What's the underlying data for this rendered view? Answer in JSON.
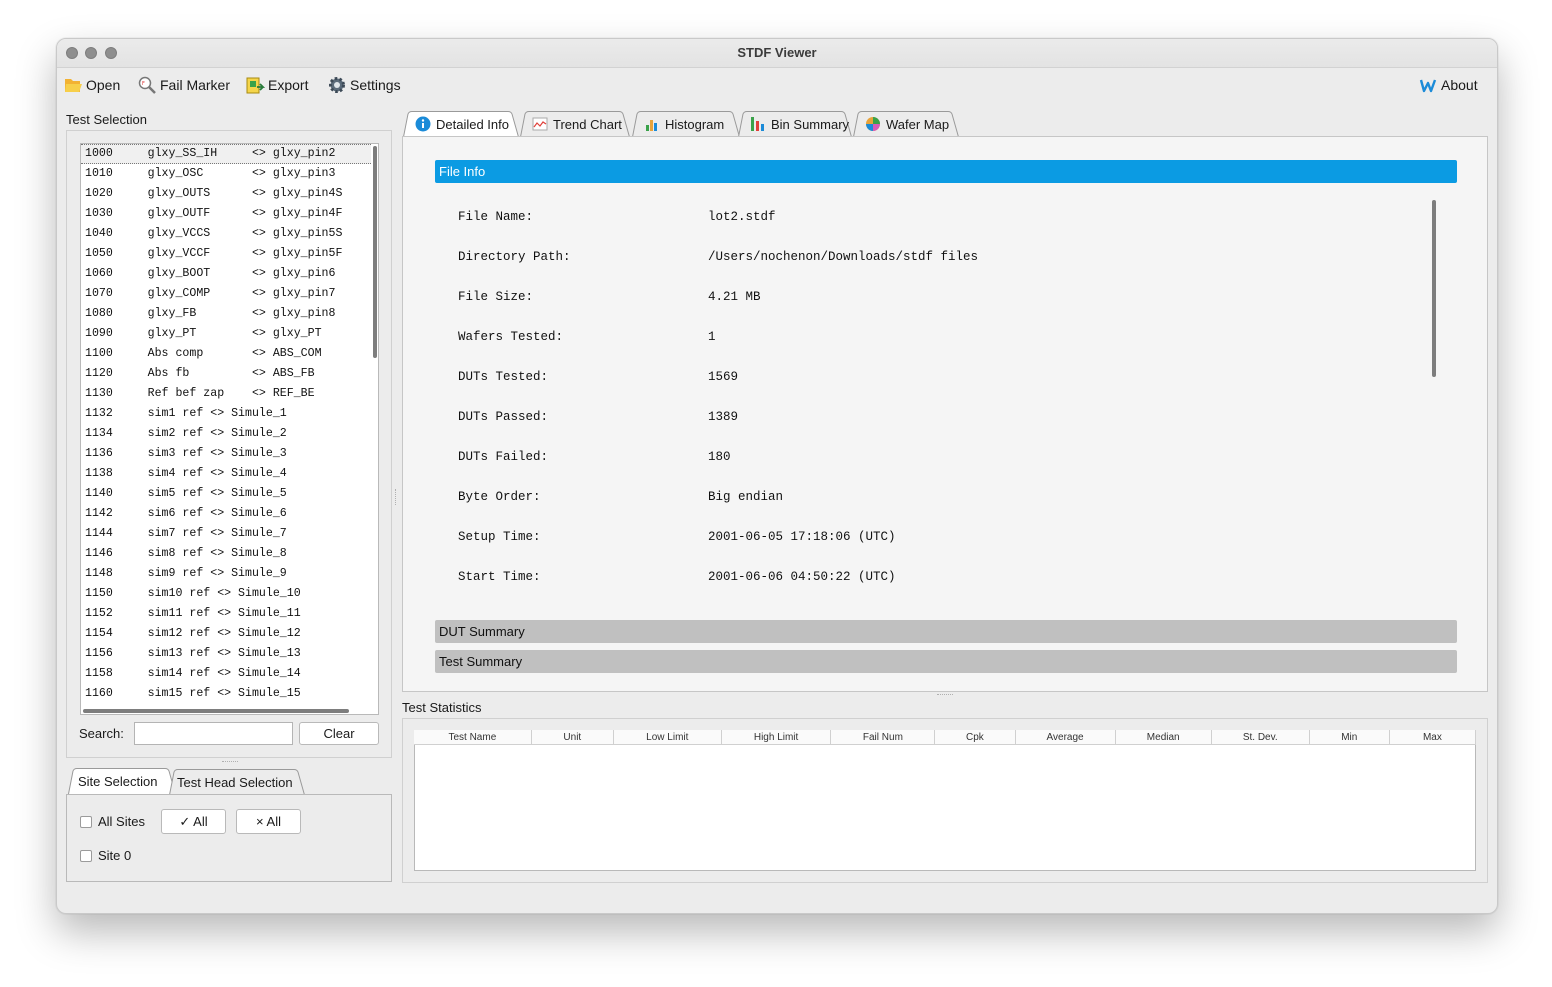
{
  "window": {
    "title": "STDF Viewer"
  },
  "toolbar": {
    "open": "Open",
    "fail_marker": "Fail Marker",
    "export": "Export",
    "settings": "Settings",
    "about": "About"
  },
  "test_selection": {
    "label": "Test Selection",
    "rows": [
      "1000     glxy_SS_IH     <> glxy_pin2",
      "1010     glxy_OSC       <> glxy_pin3",
      "1020     glxy_OUTS      <> glxy_pin4S",
      "1030     glxy_OUTF      <> glxy_pin4F",
      "1040     glxy_VCCS      <> glxy_pin5S",
      "1050     glxy_VCCF      <> glxy_pin5F",
      "1060     glxy_BOOT      <> glxy_pin6",
      "1070     glxy_COMP      <> glxy_pin7",
      "1080     glxy_FB        <> glxy_pin8",
      "1090     glxy_PT        <> glxy_PT",
      "1100     Abs comp       <> ABS_COM",
      "1120     Abs fb         <> ABS_FB",
      "1130     Ref bef zap    <> REF_BE",
      "1132     sim1 ref <> Simule_1",
      "1134     sim2 ref <> Simule_2",
      "1136     sim3 ref <> Simule_3",
      "1138     sim4 ref <> Simule_4",
      "1140     sim5 ref <> Simule_5",
      "1142     sim6 ref <> Simule_6",
      "1144     sim7 ref <> Simule_7",
      "1146     sim8 ref <> Simule_8",
      "1148     sim9 ref <> Simule_9",
      "1150     sim10 ref <> Simule_10",
      "1152     sim11 ref <> Simule_11",
      "1154     sim12 ref <> Simule_12",
      "1156     sim13 ref <> Simule_13",
      "1158     sim14 ref <> Simule_14",
      "1160     sim15 ref <> Simule_15"
    ],
    "search_label": "Search:",
    "search_value": "",
    "clear_button": "Clear"
  },
  "site_panel": {
    "tabs": [
      "Site Selection",
      "Test Head Selection"
    ],
    "all_sites": "All Sites",
    "check_all": "✓ All",
    "uncheck_all": "× All",
    "site0": "Site 0"
  },
  "main_tabs": [
    "Detailed Info",
    "Trend Chart",
    "Histogram",
    "Bin Summary",
    "Wafer Map"
  ],
  "file_info": {
    "header": "File Info",
    "rows": [
      {
        "label": "File Name:",
        "value": "lot2.stdf"
      },
      {
        "label": "Directory Path:",
        "value": "/Users/nochenon/Downloads/stdf files"
      },
      {
        "label": "File Size:",
        "value": "4.21 MB"
      },
      {
        "label": "Wafers Tested:",
        "value": "1"
      },
      {
        "label": "DUTs Tested:",
        "value": "1569"
      },
      {
        "label": "DUTs Passed:",
        "value": "1389"
      },
      {
        "label": "DUTs Failed:",
        "value": "180"
      },
      {
        "label": "Byte Order:",
        "value": "Big endian"
      },
      {
        "label": "Setup Time:",
        "value": "2001-06-05 17:18:06 (UTC)"
      },
      {
        "label": "Start Time:",
        "value": "2001-06-06 04:50:22 (UTC)"
      }
    ],
    "dut_summary": "DUT Summary",
    "test_summary": "Test Summary"
  },
  "test_statistics": {
    "label": "Test Statistics",
    "columns": [
      "Test Name",
      "Unit",
      "Low Limit",
      "High Limit",
      "Fail Num",
      "Cpk",
      "Average",
      "Median",
      "St. Dev.",
      "Min",
      "Max"
    ]
  },
  "colors": {
    "accent": "#0b9be3",
    "section_bar": "#c0c0c0"
  }
}
